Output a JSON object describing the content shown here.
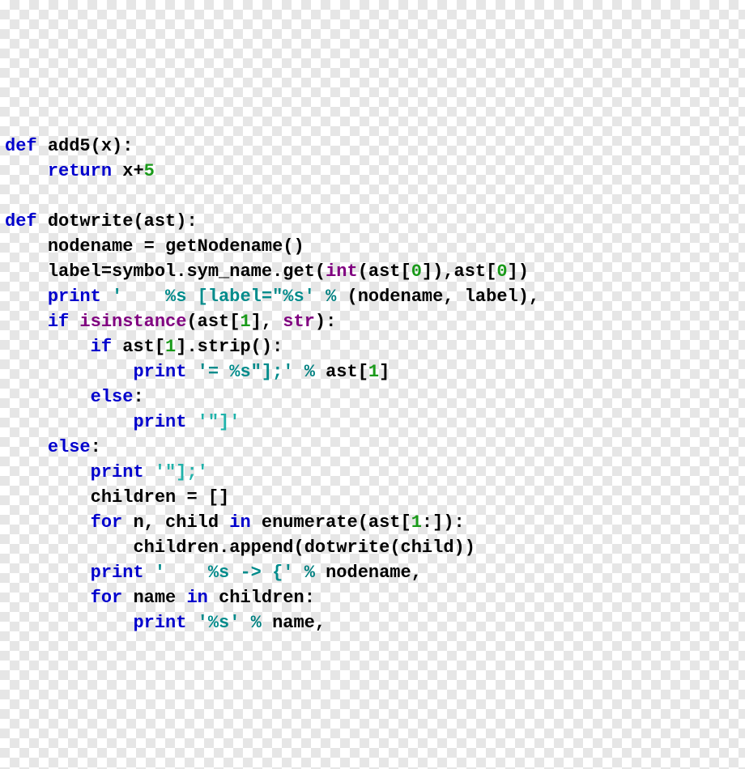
{
  "kw": {
    "def": "def",
    "return": "return",
    "if": "if",
    "else": "else",
    "for": "for",
    "in": "in",
    "print": "print"
  },
  "id": {
    "add5": "add5",
    "x": "x",
    "dotwrite": "dotwrite",
    "ast": "ast",
    "nodename": "nodename",
    "getNodename": "getNodename",
    "label": "label",
    "symbol": "symbol",
    "sym_name": "sym_name",
    "get": "get",
    "strip": "strip",
    "children": "children",
    "n": "n",
    "child": "child",
    "enumerate": "enumerate",
    "append": "append",
    "name": "name"
  },
  "bi": {
    "int": "int",
    "str": "str",
    "isinstance": "isinstance"
  },
  "num": {
    "zero": "0",
    "one": "1",
    "five": "5"
  },
  "str": {
    "label_open": "'    %s [label=\"%s'",
    "eq_close": "'= %s\"];'",
    "bracket1": "'\"]'",
    "bracket2": "'\"];'",
    "arrow": "'    %s -> {'",
    "pct_s": "'%s'"
  },
  "punc": {
    "lparen": "(",
    "rparen": ")",
    "colon": ":",
    "lbrack": "[",
    "rbrack": "]",
    "comma": ",",
    "dot": ".",
    "plus": "+",
    "eq": "=",
    "pct": "%",
    "empty_list": "[]",
    "slice1": "[1:]"
  }
}
